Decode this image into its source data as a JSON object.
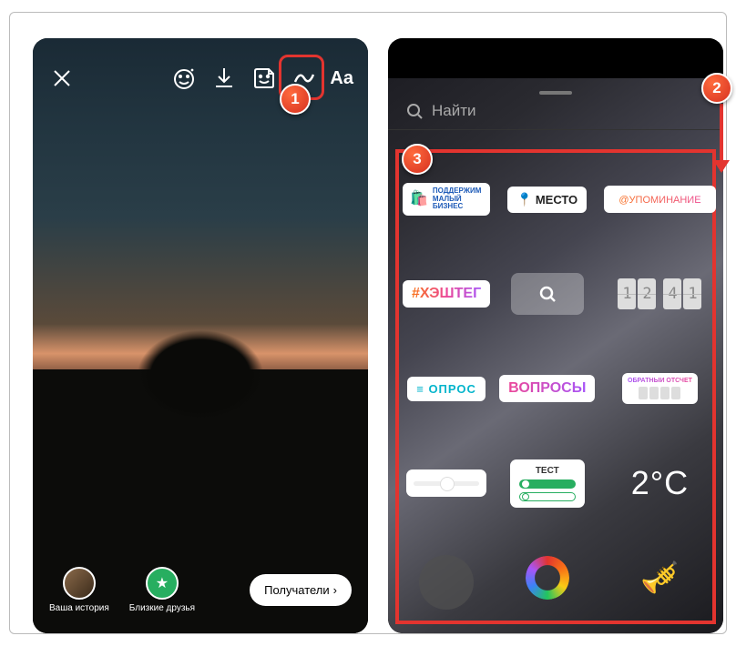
{
  "annotations": {
    "badge1": "1",
    "badge2": "2",
    "badge3": "3"
  },
  "left_screen": {
    "toolbar": {
      "close": "close",
      "effects": "face-effects",
      "download": "download",
      "sticker": "sticker",
      "draw": "draw",
      "text_label": "Aa"
    },
    "bottom": {
      "your_story": "Ваша история",
      "close_friends": "Близкие друзья",
      "recipients": "Получатели",
      "recipients_chevron": "›"
    }
  },
  "right_screen": {
    "search_placeholder": "Найти",
    "stickers": {
      "support_small_biz": "ПОДДЕРЖИМ МАЛЫЙ БИЗНЕС",
      "location": "МЕСТО",
      "mention": "@УПОМИНАНИЕ",
      "hashtag": "#ХЭШТЕГ",
      "time": {
        "d1": "1",
        "d2": "2",
        "d3": "4",
        "d4": "1"
      },
      "poll": "ОПРОС",
      "questions": "ВОПРОСЫ",
      "countdown": "ОБРАТНЫЙ ОТСЧЕТ",
      "quiz": "ТЕСТ",
      "temperature": "2°C"
    }
  }
}
